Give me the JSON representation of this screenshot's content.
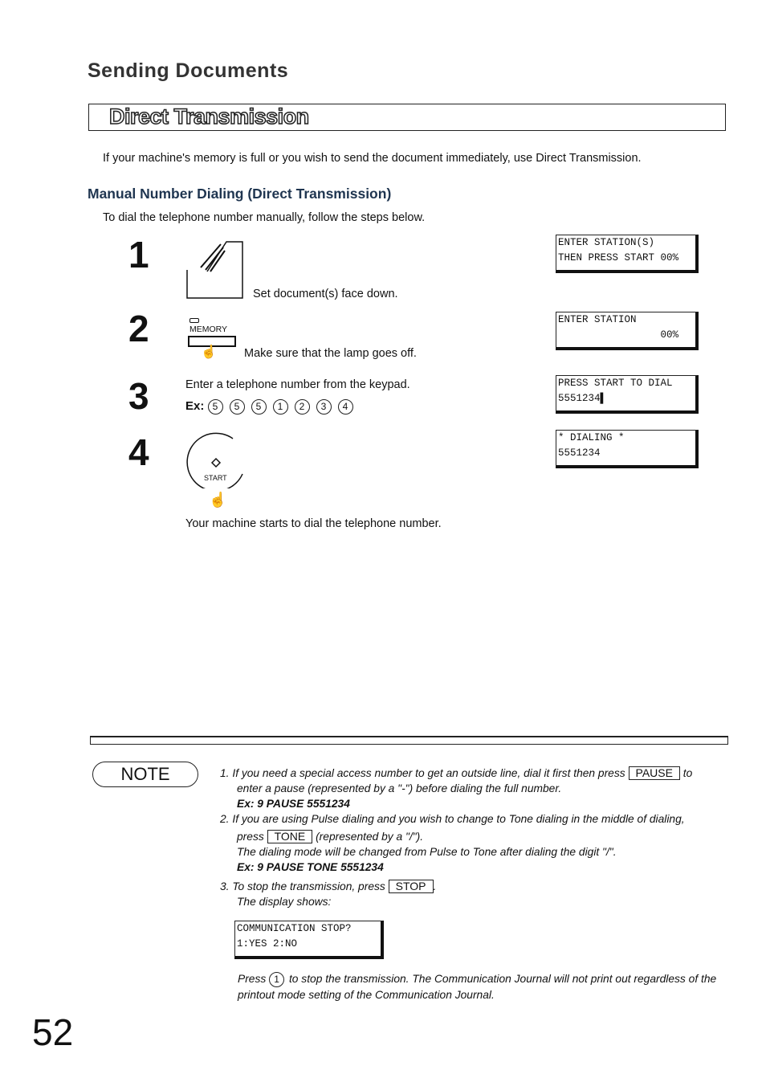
{
  "header": {
    "section_title": "Sending Documents",
    "banner_title": "Direct Transmission"
  },
  "intro": "If your machine's memory is full or you wish to send the document immediately, use Direct Transmission.",
  "subsection": {
    "title": "Manual Number Dialing (Direct Transmission)",
    "lead": "To dial the telephone number manually, follow the steps below."
  },
  "steps": [
    {
      "number": "1",
      "text": "Set document(s) face down.",
      "display": [
        "ENTER STATION(S)",
        "THEN PRESS START 00%"
      ]
    },
    {
      "number": "2",
      "key_label": "MEMORY",
      "text": "Make sure that the lamp goes off.",
      "display": [
        "ENTER STATION",
        "                 00%"
      ]
    },
    {
      "number": "3",
      "text": "Enter a telephone number from the keypad.",
      "example_prefix": "Ex:",
      "example_digits": [
        "5",
        "5",
        "5",
        "1",
        "2",
        "3",
        "4"
      ],
      "display": [
        "PRESS START TO DIAL",
        "5551234▌"
      ]
    },
    {
      "number": "4",
      "key_label": "START",
      "text": "Your machine starts to dial the telephone number.",
      "display": [
        "* DIALING *",
        "5551234"
      ]
    }
  ],
  "note": {
    "label": "NOTE",
    "item1": {
      "n": "1.",
      "a": "If you need a special access number to get an outside line, dial it first then press",
      "key": "PAUSE",
      "b": "to",
      "c": "enter a pause (represented by a \"-\") before dialing the full number.",
      "ex": "Ex: 9 PAUSE 5551234"
    },
    "item2": {
      "n": "2.",
      "a": "If you are using Pulse dialing and you wish to change to Tone dialing in the middle of dialing,",
      "b": "press",
      "key": "TONE",
      "c": "(represented by a \"/\").",
      "d": "The dialing mode will be changed from Pulse to Tone after dialing the digit \"/\".",
      "ex": "Ex: 9 PAUSE TONE 5551234"
    },
    "item3": {
      "n": "3.",
      "a": "To stop the transmission, press",
      "key": "STOP",
      "b": ".",
      "c": "The display shows:",
      "display": [
        "COMMUNICATION STOP?",
        "1:YES 2:NO"
      ],
      "d": "Press",
      "digit": "1",
      "e": "to stop the transmission. The Communication Journal will not print out regardless of the printout mode setting of the Communication Journal."
    }
  },
  "page_number": "52"
}
